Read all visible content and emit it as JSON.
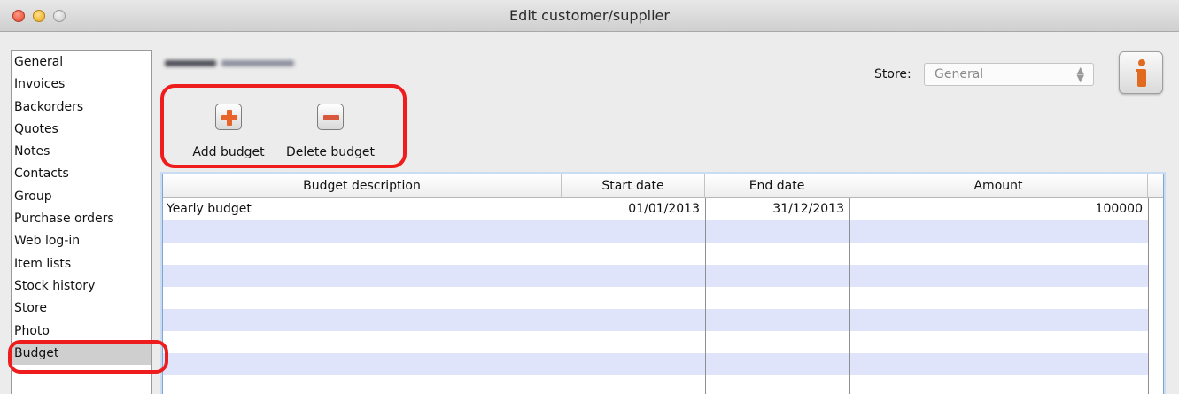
{
  "window": {
    "title": "Edit customer/supplier"
  },
  "sidebar": {
    "items": [
      {
        "label": "General"
      },
      {
        "label": "Invoices"
      },
      {
        "label": "Backorders"
      },
      {
        "label": "Quotes"
      },
      {
        "label": "Notes"
      },
      {
        "label": "Contacts"
      },
      {
        "label": "Group"
      },
      {
        "label": "Purchase orders"
      },
      {
        "label": "Web log-in"
      },
      {
        "label": "Item lists"
      },
      {
        "label": "Stock history"
      },
      {
        "label": "Store"
      },
      {
        "label": "Photo"
      },
      {
        "label": "Budget"
      }
    ],
    "selected": "Budget"
  },
  "store": {
    "label": "Store:",
    "value": "General"
  },
  "toolbar": {
    "add_label": "Add budget",
    "delete_label": "Delete budget"
  },
  "table": {
    "columns": [
      "Budget description",
      "Start date",
      "End date",
      "Amount"
    ],
    "rows": [
      {
        "description": "Yearly budget",
        "start": "01/01/2013",
        "end": "31/12/2013",
        "amount": "100000"
      }
    ]
  },
  "colors": {
    "highlight": "#ee1c1c",
    "row_alt": "#dfe4fb",
    "add_icon": "#e8642b",
    "delete_icon": "#d9573a",
    "info_icon": "#e06a1f"
  },
  "icons": {
    "info": "info-icon",
    "add": "plus-icon",
    "delete": "minus-icon",
    "select_arrows": "up-down-arrows-icon"
  }
}
